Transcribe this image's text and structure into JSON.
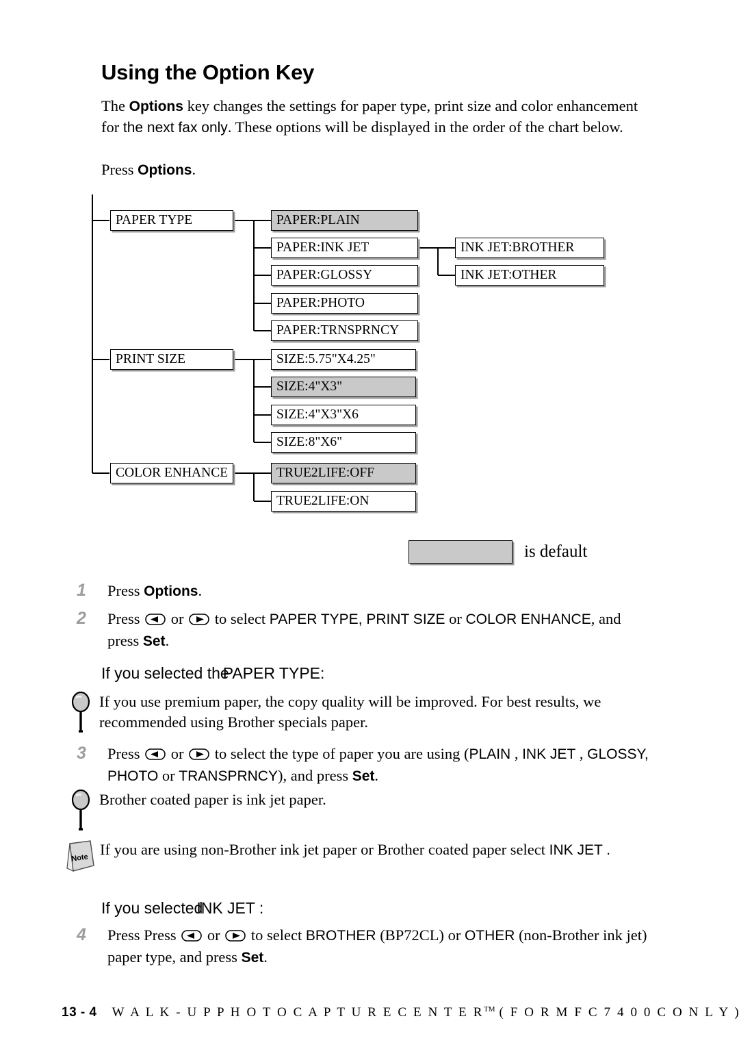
{
  "page": {
    "heading": "Using the Option Key",
    "intro": {
      "part1": "The ",
      "bold1": "Options",
      "part2": " key changes the settings for paper type, print size and color enhancement for ",
      "sans1": "the next fax only",
      "part3": ". These options will be displayed in the order of the chart below."
    },
    "press_options": {
      "pre": "Press ",
      "bold": "Options",
      "post": "."
    }
  },
  "chart_data": {
    "type": "diagram",
    "title": "Options key menu tree",
    "legend": {
      "swatch": "filled-gray",
      "label": "is default",
      "default_color": "#c9c9c9"
    },
    "categories": [
      {
        "label": "PAPER TYPE",
        "options": [
          {
            "label": "PAPER:PLAIN",
            "default": true
          },
          {
            "label": "PAPER:INK JET",
            "default": false,
            "children": [
              {
                "label": "INK JET:BROTHER",
                "default": false
              },
              {
                "label": "INK JET:OTHER",
                "default": false
              }
            ]
          },
          {
            "label": "PAPER:GLOSSY",
            "default": false
          },
          {
            "label": "PAPER:PHOTO",
            "default": false
          },
          {
            "label": "PAPER:TRNSPRNCY",
            "default": false
          }
        ]
      },
      {
        "label": "PRINT SIZE",
        "options": [
          {
            "label": "SIZE:5.75\"X4.25\"",
            "default": false
          },
          {
            "label": "SIZE:4\"X3\"",
            "default": true
          },
          {
            "label": "SIZE:4\"X3\"X6",
            "default": false
          },
          {
            "label": "SIZE:8\"X6\"",
            "default": false
          }
        ]
      },
      {
        "label": "COLOR ENHANCE",
        "options": [
          {
            "label": "TRUE2LIFE:OFF",
            "default": true
          },
          {
            "label": "TRUE2LIFE:ON",
            "default": false
          }
        ]
      }
    ]
  },
  "steps": [
    {
      "num": "1",
      "pre": "Press ",
      "bold": "Options",
      "post": "."
    },
    {
      "num": "2",
      "t1": "Press ",
      "key_left": "left-arrow-key",
      "t2": " or ",
      "key_right": "right-arrow-key",
      "t3": " to select ",
      "s1": "PAPER TYPE, PRINT SIZE",
      "t4": " or ",
      "s2": "COLOR ENHANCE",
      "t5": ", and press ",
      "bold": "Set",
      "post": "."
    },
    {
      "num": "3",
      "t1": "Press ",
      "key_left": "left-arrow-key",
      "t2": " or ",
      "key_right": "right-arrow-key",
      "t3": " to select the type of paper you are using (",
      "s1": "PLAIN",
      "t4": " , ",
      "s2": "INK JET",
      "t5": " , ",
      "s3": "GLOSSY, PHOTO",
      "t6": " or ",
      "s4": "TRANSPRNCY",
      "t7": "), and press ",
      "bold": "Set",
      "post": "."
    },
    {
      "num": "4",
      "t1": "Press Press ",
      "key_left": "left-arrow-key",
      "t2": " or ",
      "key_right": "right-arrow-key",
      "t3": " to select ",
      "s1": "BROTHER",
      "t4": " (BP72CL) or ",
      "s2": "OTHER",
      "t5": " (non-Brother ink jet) paper type, and press ",
      "bold": "Set",
      "post": "."
    }
  ],
  "subheads": {
    "paper_type": {
      "pre": "If you selected the",
      "term": "PAPER TYPE:"
    },
    "ink_jet": {
      "pre": "If you selected",
      "term": "INK JET :"
    }
  },
  "tips": [
    {
      "icon": "tip-magnifier-icon",
      "text": "If you use premium paper, the copy quality will be improved. For best results, we recommended using Brother specials paper."
    },
    {
      "icon": "tip-magnifier-icon",
      "text": "Brother coated paper is ink jet paper."
    }
  ],
  "note": {
    "icon": "note-icon",
    "icon_label": "Note",
    "text": "If you are using non-Brother ink jet paper or Brother coated paper select ",
    "term": "INK JET",
    "tail": " ."
  },
  "footer": {
    "page_number": "13 - 4",
    "title": "W A L K - U P   P H O T O C A P T U R E   C E N T E R",
    "tm": "TM",
    "suffix": "( F O R   M F C   7 4 0 0 C   O N L Y )"
  }
}
